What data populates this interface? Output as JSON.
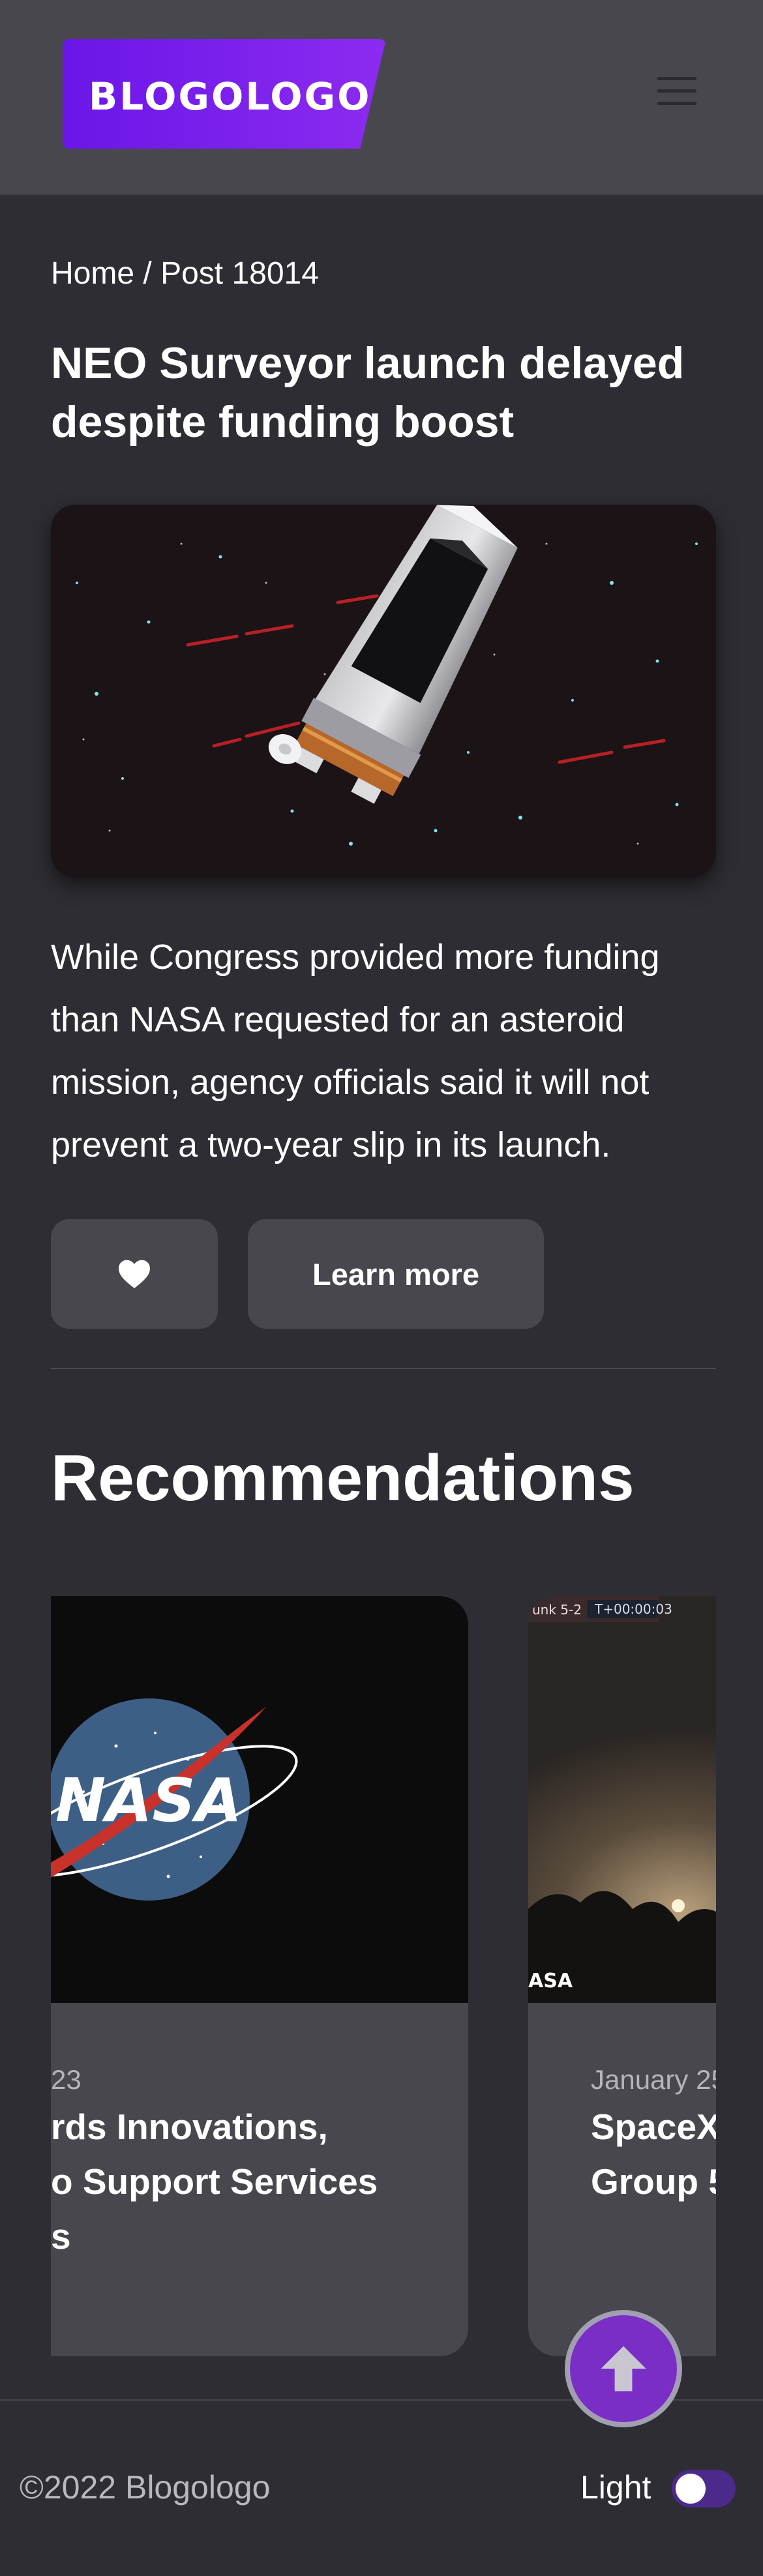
{
  "header": {
    "logo_text": "BLOGOLOGO",
    "menu_icon": "hamburger-menu-icon"
  },
  "breadcrumb": {
    "home": "Home",
    "separator": " / ",
    "current": "Post 18014"
  },
  "post": {
    "title": "NEO Surveyor launch delayed despite funding boost",
    "image_icon": "telescope-image",
    "description": "While Congress provided more funding than NASA requested for an asteroid mission, agency officials said it will not prevent a two-year slip in its launch.",
    "like_icon": "heart-icon",
    "learn_more_label": "Learn more"
  },
  "recommendations": {
    "heading": "Recommendations",
    "cards": [
      {
        "date": "23",
        "title": "rds Innovations, o Support Services s",
        "title_lines": [
          "rds Innovations,",
          "o Support Services",
          "s"
        ],
        "image_icon": "nasa-logo-image"
      },
      {
        "date": "January 25",
        "title": "SpaceX Group 5",
        "title_lines": [
          "SpaceX",
          "Group 5"
        ],
        "overlay_left": "unk 5-2",
        "overlay_right": "T+00:00:03",
        "watermark": "ASA"
      }
    ]
  },
  "footer": {
    "copyright": "©2022 Blogologo",
    "theme_label": "Light",
    "theme_dark": false
  },
  "scroll_top_icon": "arrow-up-icon",
  "colors": {
    "accent": "#7a2ec6",
    "logo_gradient_start": "#6a16e8",
    "logo_gradient_end": "#8c2bf0",
    "background": "#2e2d33",
    "surface": "#48474d"
  }
}
